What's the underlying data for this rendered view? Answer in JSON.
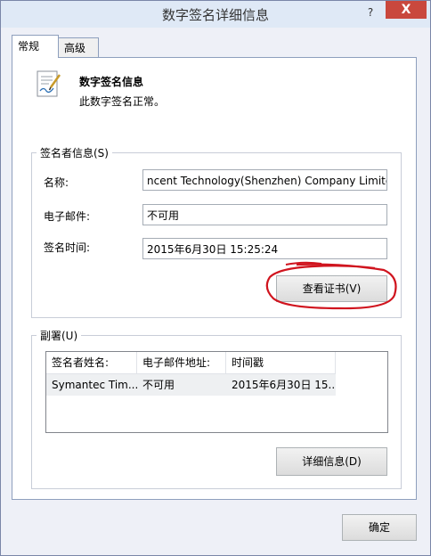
{
  "window": {
    "title": "数字签名详细信息",
    "help": "?",
    "close": "X"
  },
  "tabs": [
    {
      "label": "常规",
      "active": true
    },
    {
      "label": "高级",
      "active": false
    }
  ],
  "info": {
    "title": "数字签名信息",
    "status": "此数字签名正常。"
  },
  "signer": {
    "group_label": "签名者信息(S)",
    "name_label": "名称:",
    "name_value": "ncent Technology(Shenzhen) Company Limited",
    "email_label": "电子邮件:",
    "email_value": "不可用",
    "time_label": "签名时间:",
    "time_value": "2015年6月30日 15:25:24",
    "view_cert_button": "查看证书(V)"
  },
  "countersign": {
    "group_label": "副署(U)",
    "columns": [
      "签名者姓名:",
      "电子邮件地址:",
      "时间戳"
    ],
    "rows": [
      [
        "Symantec Tim...",
        "不可用",
        "2015年6月30日 15..."
      ]
    ],
    "details_button": "详细信息(D)"
  },
  "ok_button": "确定",
  "colors": {
    "window_bg": "#eef0f7",
    "close_red": "#c9483d",
    "annotation_red": "#d0141e"
  }
}
